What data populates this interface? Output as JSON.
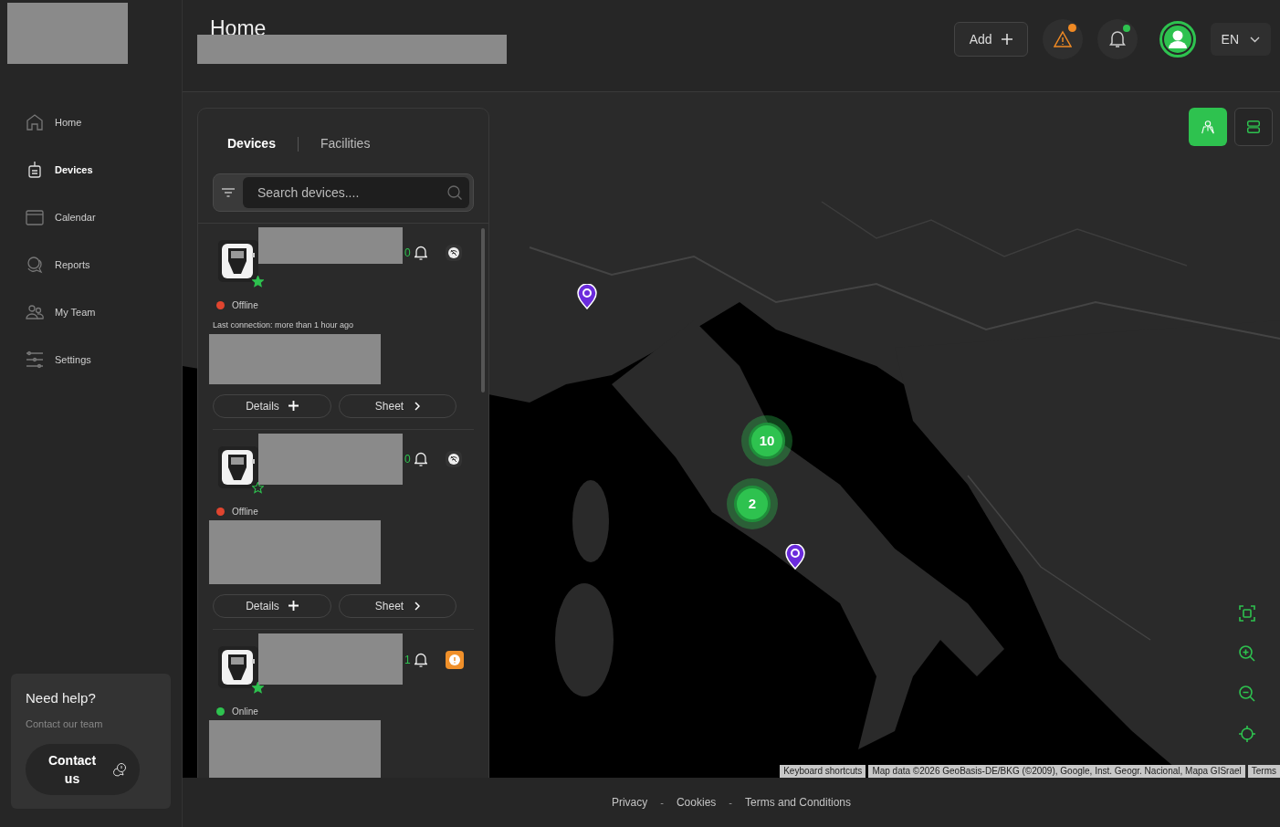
{
  "sidebar": {
    "items": [
      {
        "label": "Home",
        "selected": false
      },
      {
        "label": "Devices",
        "selected": true
      },
      {
        "label": "Calendar",
        "selected": false
      },
      {
        "label": "Reports",
        "selected": false
      },
      {
        "label": "My Team",
        "selected": false
      },
      {
        "label": "Settings",
        "selected": false
      }
    ]
  },
  "help_card": {
    "title": "Need help?",
    "subtitle": "Contact our team",
    "button": "Contact us"
  },
  "header": {
    "title": "Home",
    "add_button": "Add",
    "language": "EN"
  },
  "device_panel": {
    "tabs": [
      {
        "label": "Devices",
        "selected": true
      },
      {
        "label": "Facilities",
        "selected": false
      }
    ],
    "search": {
      "placeholder": "Search devices...."
    },
    "devices": [
      {
        "alarms": "0",
        "kind": "offline",
        "favorite": true,
        "status": "Offline",
        "color": "#e0452f",
        "last_connection": "Last connection: more than 1 hour ago",
        "details_button": "Details",
        "sheet_button": "Sheet"
      },
      {
        "alarms": "0",
        "kind": "offline",
        "favorite": false,
        "status": "Offline",
        "color": "#e0452f",
        "details_button": "Details",
        "sheet_button": "Sheet"
      },
      {
        "alarms": "1",
        "kind": "alert",
        "favorite": true,
        "status": "Online",
        "color": "#2ec24f"
      }
    ]
  },
  "map": {
    "view_toggles": [
      {
        "kind": "map",
        "selected": true
      },
      {
        "kind": "list",
        "selected": false
      }
    ],
    "clusters": [
      {
        "count": "10"
      },
      {
        "count": "2"
      }
    ],
    "attribution": [
      "Keyboard shortcuts",
      "Map data ©2026 GeoBasis-DE/BKG (©2009), Google, Inst. Geogr. Nacional, Mapa GISrael",
      "Terms"
    ]
  },
  "footer": {
    "items": [
      {
        "kind": "link",
        "text": "Privacy"
      },
      {
        "kind": "separator",
        "text": "-"
      },
      {
        "kind": "link",
        "text": "Cookies"
      },
      {
        "kind": "separator",
        "text": "-"
      },
      {
        "kind": "link",
        "text": "Terms and Conditions"
      }
    ]
  }
}
